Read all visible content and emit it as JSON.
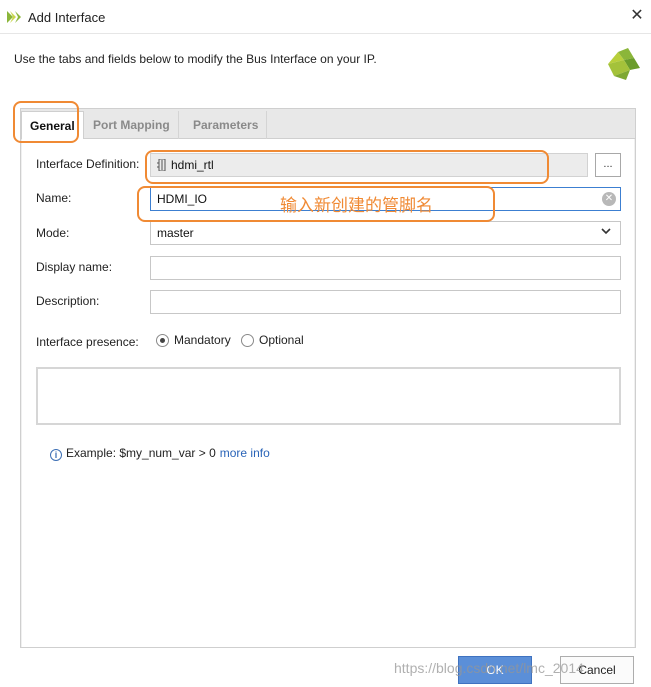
{
  "window": {
    "title": "Add Interface"
  },
  "header": {
    "subtitle": "Use the tabs and fields below to modify the Bus Interface on your IP."
  },
  "tabs": [
    {
      "label": "General",
      "active": true
    },
    {
      "label": "Port Mapping",
      "active": false
    },
    {
      "label": "Parameters",
      "active": false
    }
  ],
  "form": {
    "interface_definition": {
      "label": "Interface Definition:",
      "value": "hdmi_rtl",
      "browse_label": "..."
    },
    "name": {
      "label": "Name:",
      "value": "HDMI_IO"
    },
    "mode": {
      "label": "Mode:",
      "value": "master"
    },
    "display_name": {
      "label": "Display name:",
      "value": ""
    },
    "description": {
      "label": "Description:",
      "value": ""
    },
    "presence": {
      "label": "Interface presence:",
      "options": [
        {
          "label": "Mandatory",
          "checked": true
        },
        {
          "label": "Optional",
          "checked": false
        }
      ]
    },
    "example": {
      "text": "Example:  $my_num_var > 0",
      "link": "more info"
    }
  },
  "annotation": {
    "text": "输入新创建的管脚名",
    "color": "#f08a34"
  },
  "buttons": {
    "ok": "OK",
    "cancel": "Cancel"
  },
  "watermark": "https://blog.csdn.net/lmc_2014",
  "colors": {
    "accent": "#5b8fd8",
    "annotation": "#f08a34",
    "link": "#2a64b8"
  }
}
